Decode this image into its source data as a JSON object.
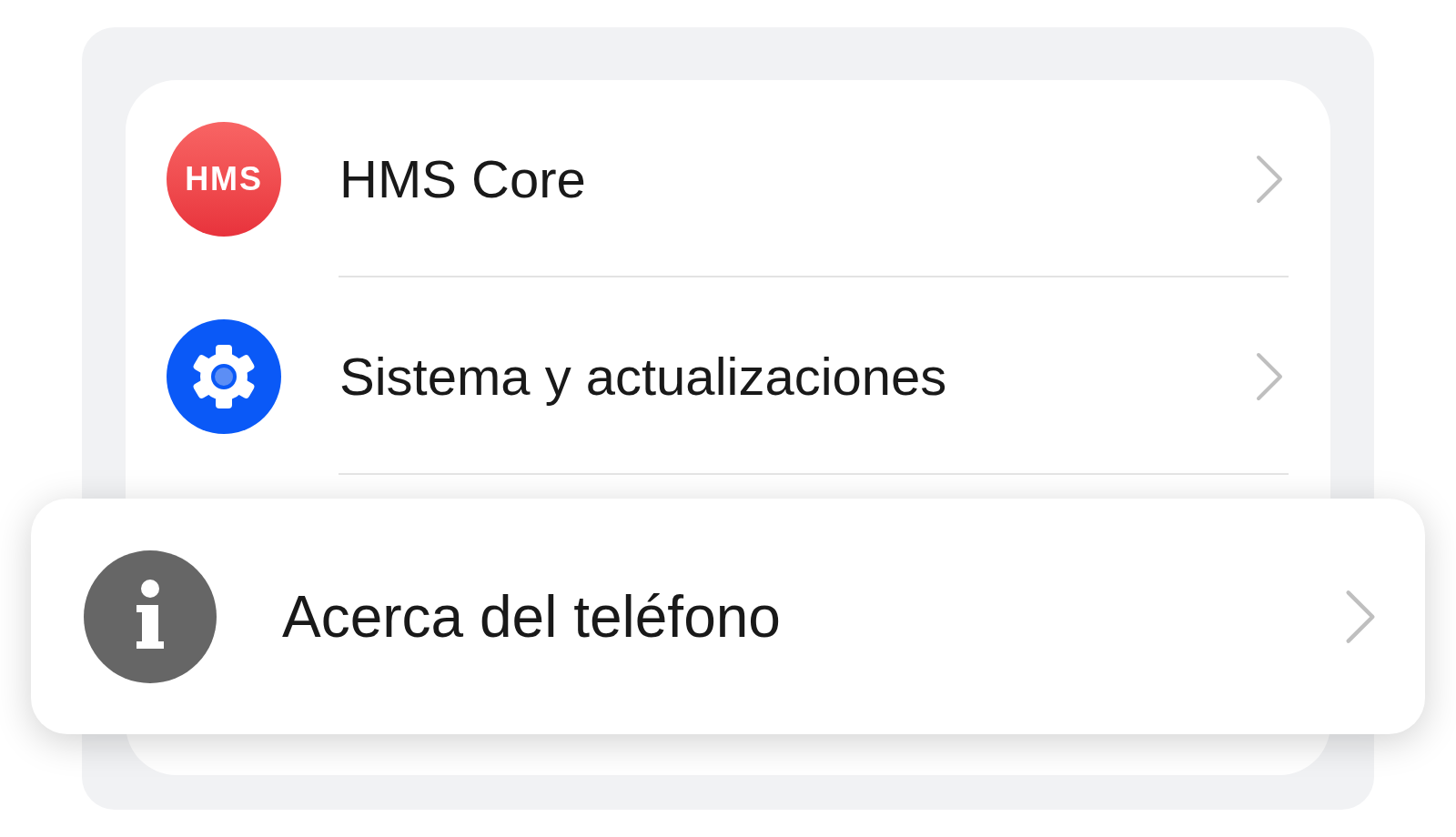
{
  "settings_items": [
    {
      "kind": "hms",
      "icon_text": "HMS",
      "label": "HMS Core",
      "selected": false
    },
    {
      "kind": "gear",
      "label": "Sistema y actualizaciones",
      "selected": false
    },
    {
      "kind": "info",
      "label": "Acerca del teléfono",
      "selected": true
    }
  ]
}
